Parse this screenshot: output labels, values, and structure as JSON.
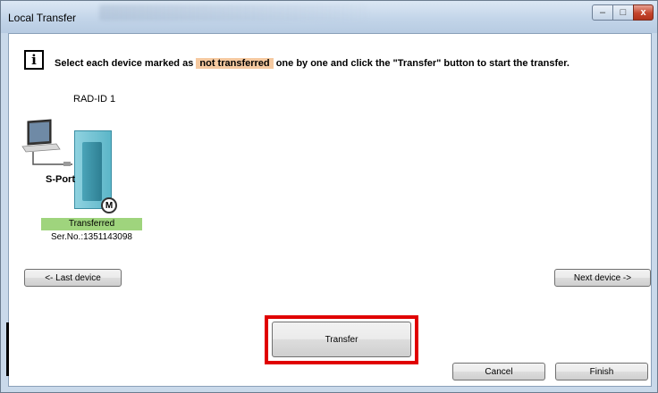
{
  "window": {
    "title": "Local Transfer",
    "controls": {
      "minimize": "–",
      "maximize": "□",
      "close": "x"
    }
  },
  "instruction": {
    "before": "Select each device marked as",
    "highlight": "not transferred",
    "after": "one by one and click the \"Transfer\" button to start the transfer.",
    "highlight_color": "#f5c9a0"
  },
  "device": {
    "group_label": "RAD-ID 1",
    "port_label": "S-Port",
    "badge": "M",
    "status": "Transferred",
    "status_color": "#9fd47d",
    "serial": "Ser.No.:1351143098"
  },
  "buttons": {
    "last_device": "<- Last device",
    "next_device": "Next device ->",
    "transfer": "Transfer",
    "cancel": "Cancel",
    "finish": "Finish"
  },
  "colors": {
    "highlight_frame": "#e00000"
  }
}
